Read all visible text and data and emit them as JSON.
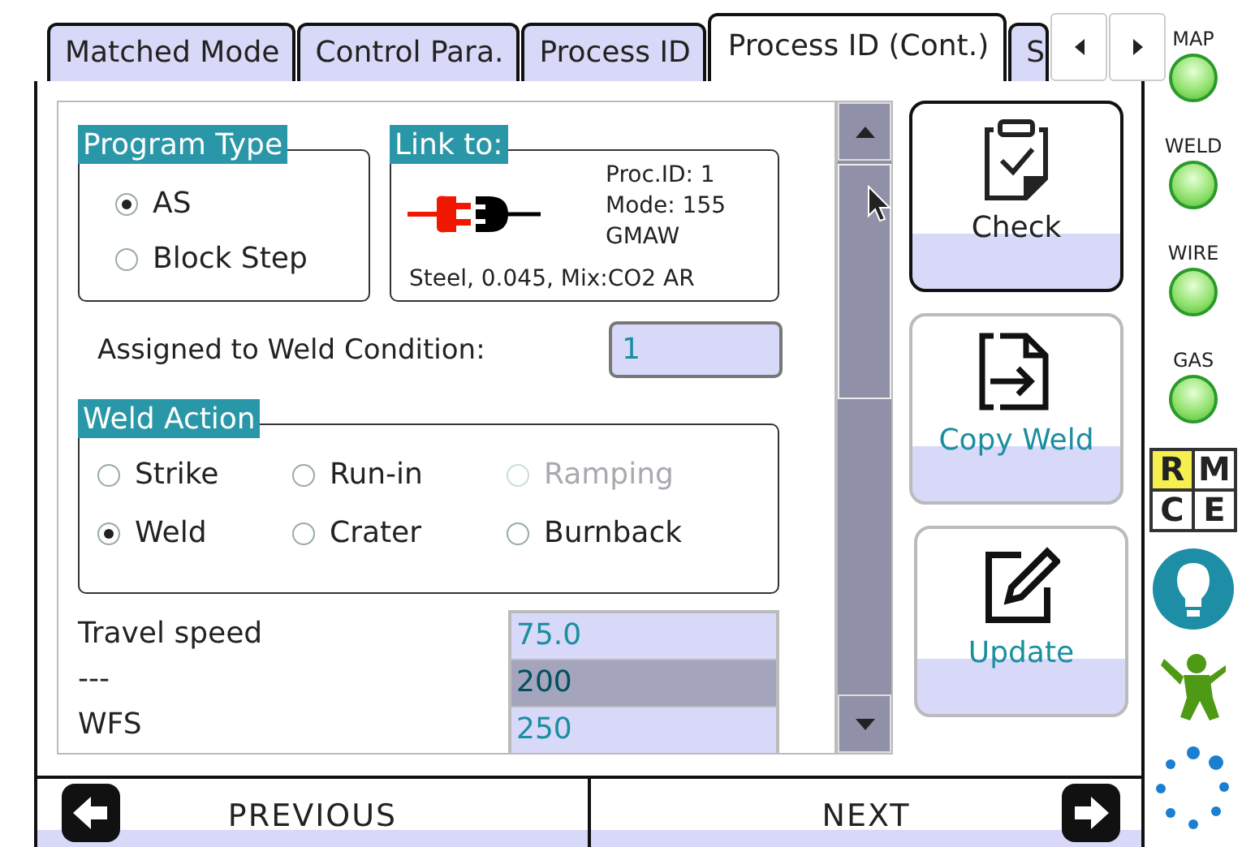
{
  "tabs": [
    {
      "label": "Matched Mode",
      "selected": false
    },
    {
      "label": "Control Para.",
      "selected": false
    },
    {
      "label": "Process ID",
      "selected": false
    },
    {
      "label": "Process ID (Cont.)",
      "selected": true
    },
    {
      "label": "S",
      "selected": false
    }
  ],
  "program_type": {
    "title": "Program Type",
    "options": [
      {
        "label": "AS",
        "selected": true
      },
      {
        "label": "Block Step",
        "selected": false
      }
    ]
  },
  "link_to": {
    "title": "Link to:",
    "proc_id": "Proc.ID: 1",
    "mode": "Mode: 155",
    "process": "GMAW",
    "material": "Steel, 0.045, Mix:CO2 AR"
  },
  "assigned": {
    "label": "Assigned to Weld Condition:",
    "value": "1"
  },
  "weld_action": {
    "title": "Weld Action",
    "options": [
      {
        "label": "Strike",
        "selected": false,
        "disabled": false
      },
      {
        "label": "Run-in",
        "selected": false,
        "disabled": false
      },
      {
        "label": "Ramping",
        "selected": false,
        "disabled": true
      },
      {
        "label": "Weld",
        "selected": true,
        "disabled": false
      },
      {
        "label": "Crater",
        "selected": false,
        "disabled": false
      },
      {
        "label": "Burnback",
        "selected": false,
        "disabled": false
      }
    ]
  },
  "parameters": [
    "Travel speed",
    "---",
    "WFS"
  ],
  "values": [
    {
      "label": "75.0",
      "selected": false
    },
    {
      "label": "200",
      "selected": true
    },
    {
      "label": "250",
      "selected": false
    }
  ],
  "actions": [
    {
      "label": "Check",
      "kind": "check",
      "focused": true
    },
    {
      "label": "Copy Weld",
      "kind": "copy",
      "focused": false
    },
    {
      "label": "Update",
      "kind": "edit",
      "focused": false
    }
  ],
  "navigation": {
    "previous": "PREVIOUS",
    "next": "NEXT"
  },
  "indicators": [
    {
      "label": "MAP",
      "on": true
    },
    {
      "label": "WELD",
      "on": true
    },
    {
      "label": "WIRE",
      "on": true
    },
    {
      "label": "GAS",
      "on": true
    }
  ],
  "logo_letters": [
    "R",
    "M",
    "C",
    "E"
  ]
}
